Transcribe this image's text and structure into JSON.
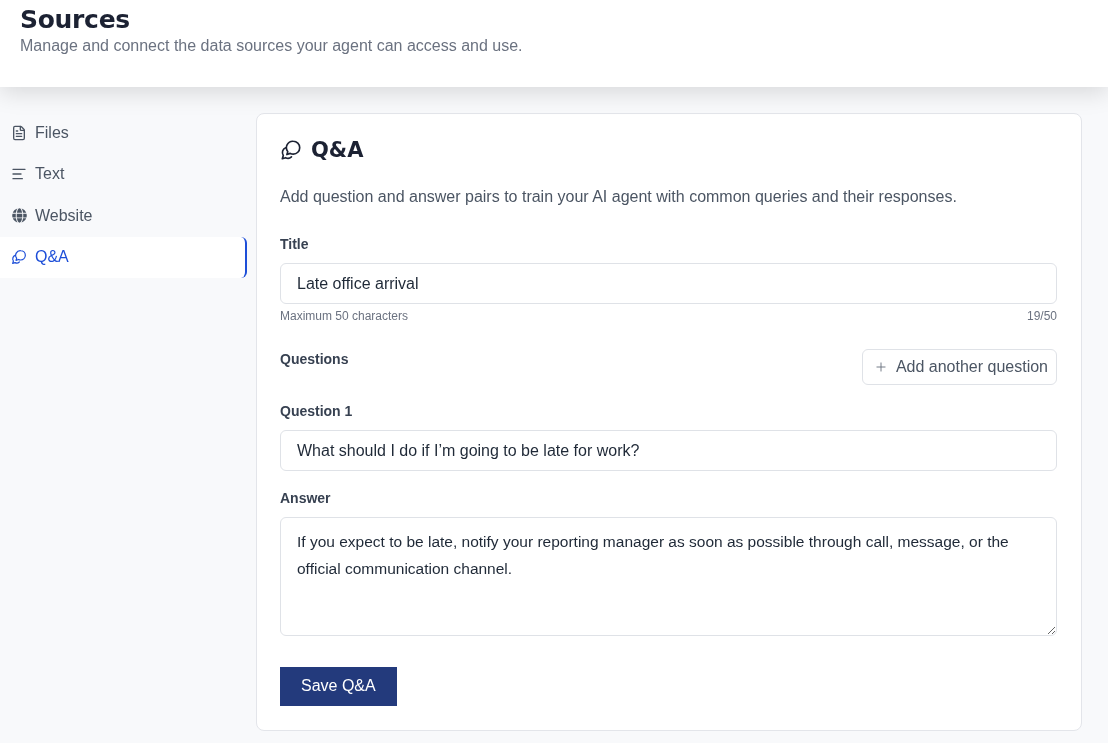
{
  "header": {
    "title": "Sources",
    "subtitle": "Manage and connect the data sources your agent can access and use."
  },
  "sidebar": {
    "items": [
      {
        "label": "Files",
        "selected": false
      },
      {
        "label": "Text",
        "selected": false
      },
      {
        "label": "Website",
        "selected": false
      },
      {
        "label": "Q&A",
        "selected": true
      }
    ]
  },
  "panel": {
    "title": "Q&A",
    "description": "Add question and answer pairs to train your AI agent with common queries and their responses.",
    "title_field": {
      "label": "Title",
      "value": "Late office arrival",
      "hint": "Maximum 50 characters",
      "counter": "19/50"
    },
    "questions": {
      "label": "Questions",
      "add_button": "Add another question",
      "items": [
        {
          "label": "Question 1",
          "value": "What should I do if I’m going to be late for work?"
        }
      ]
    },
    "answer": {
      "label": "Answer",
      "value": "If you expect to be late, notify your reporting manager as soon as possible through call, message, or the official communication channel."
    },
    "save_button": "Save Q&A"
  }
}
